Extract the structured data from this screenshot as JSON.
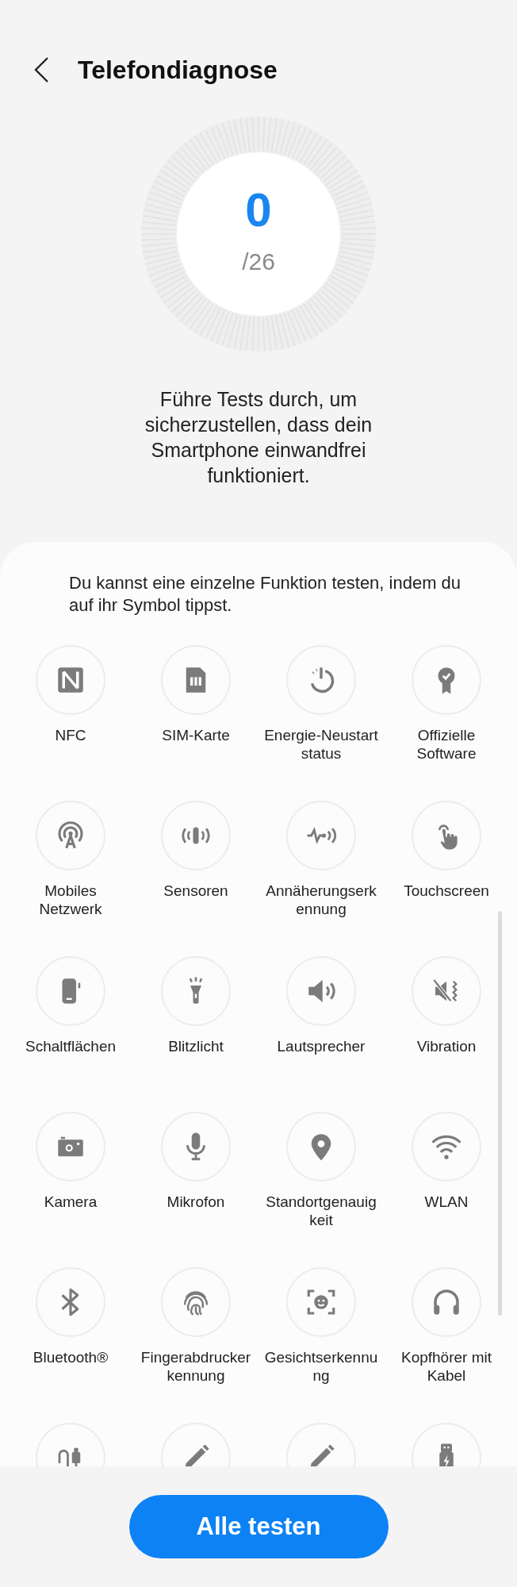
{
  "header": {
    "title": "Telefondiagnose"
  },
  "progress": {
    "count": "0",
    "total": "/26"
  },
  "description": "Führe Tests durch, um sicherzustellen, dass dein Smartphone einwandfrei funktioniert.",
  "hint": "Du kannst eine einzelne Funktion testen, indem du auf ihr Symbol tippst.",
  "tests": [
    {
      "kind": "nfc",
      "label": "NFC"
    },
    {
      "kind": "sim",
      "label": "SIM-Karte"
    },
    {
      "kind": "power",
      "label": "Energie-Neustart\nstatus"
    },
    {
      "kind": "certificate",
      "label": "Offizielle\nSoftware"
    },
    {
      "kind": "antenna",
      "label": "Mobiles\nNetzwerk"
    },
    {
      "kind": "sensor",
      "label": "Sensoren"
    },
    {
      "kind": "proximity",
      "label": "Annäherungserk\nennung"
    },
    {
      "kind": "touch",
      "label": "Touchscreen"
    },
    {
      "kind": "buttons",
      "label": "Schaltflächen"
    },
    {
      "kind": "flashlight",
      "label": "Blitzlicht"
    },
    {
      "kind": "speaker",
      "label": "Lautsprecher"
    },
    {
      "kind": "vibration",
      "label": "Vibration"
    },
    {
      "kind": "camera",
      "label": "Kamera"
    },
    {
      "kind": "mic",
      "label": "Mikrofon"
    },
    {
      "kind": "location",
      "label": "Standortgenauig\nkeit"
    },
    {
      "kind": "wifi",
      "label": "WLAN"
    },
    {
      "kind": "bluetooth",
      "label": "Bluetooth®"
    },
    {
      "kind": "fingerprint",
      "label": "Fingerabdrucker\nkennung"
    },
    {
      "kind": "face",
      "label": "Gesichtserkennu\nng"
    },
    {
      "kind": "headphones",
      "label": "Kopfhörer mit\nKabel"
    },
    {
      "kind": "cable"
    },
    {
      "kind": "pen"
    },
    {
      "kind": "pen"
    },
    {
      "kind": "usb"
    }
  ],
  "action": {
    "label": "Alle testen"
  }
}
